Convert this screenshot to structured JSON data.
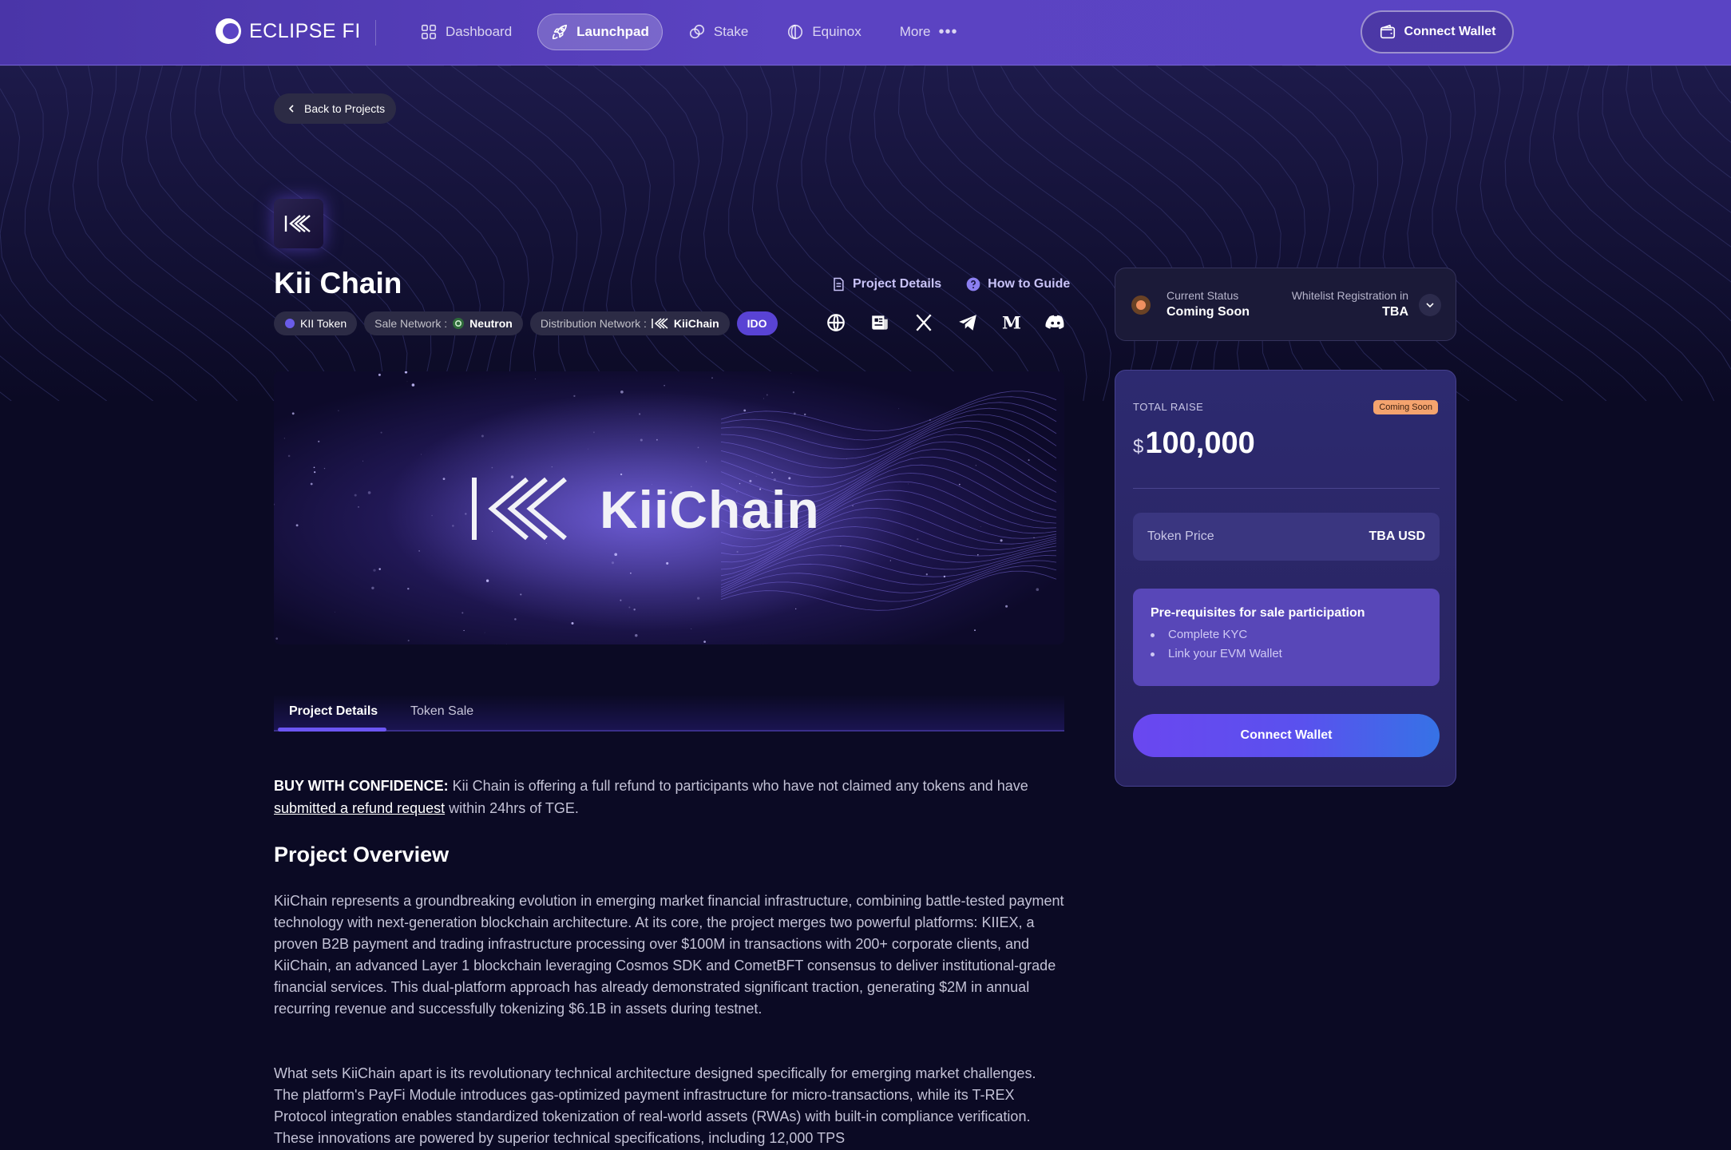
{
  "nav": {
    "brand": "ECLIPSE FI",
    "items": [
      {
        "label": "Dashboard",
        "icon": "grid-icon"
      },
      {
        "label": "Launchpad",
        "icon": "rocket-icon",
        "active": true
      },
      {
        "label": "Stake",
        "icon": "coins-icon"
      },
      {
        "label": "Equinox",
        "icon": "equinox-icon"
      },
      {
        "label": "More",
        "icon": "more-dots-icon"
      }
    ],
    "more_dots": "•••",
    "wallet_label": "Connect Wallet"
  },
  "back": {
    "label": "Back to Projects"
  },
  "project": {
    "title": "Kii Chain",
    "links": {
      "details": "Project Details",
      "guide": "How to Guide"
    },
    "tags": {
      "token": "KII Token",
      "sale_network_label": "Sale Network :",
      "sale_network_value": "Neutron",
      "distribution_label": "Distribution Network :",
      "distribution_value": "KiiChain",
      "type": "IDO"
    },
    "socials": [
      "globe-icon",
      "docs-icon",
      "x-icon",
      "telegram-icon",
      "medium-icon",
      "discord-icon"
    ],
    "banner_text": "KiiChain"
  },
  "tabs": [
    {
      "label": "Project Details",
      "active": true
    },
    {
      "label": "Token Sale",
      "active": false
    }
  ],
  "content": {
    "confidence_bold": "BUY WITH CONFIDENCE:",
    "confidence_text1": " Kii Chain is offering a full refund to participants who have not claimed any tokens and have ",
    "confidence_link": "submitted a refund request",
    "confidence_text2": " within 24hrs of TGE.",
    "overview_title": "Project Overview",
    "para1": "KiiChain represents a groundbreaking evolution in emerging market financial infrastructure, combining battle-tested payment technology with next-generation blockchain architecture. At its core, the project merges two powerful platforms: KIIEX, a proven B2B payment and trading infrastructure processing over $100M in transactions with 200+ corporate clients, and KiiChain, an advanced Layer 1 blockchain leveraging Cosmos SDK and CometBFT consensus to deliver institutional-grade financial services. This dual-platform approach has already demonstrated significant traction, generating $2M in annual recurring revenue and successfully tokenizing $6.1B in assets during testnet.",
    "para2": "What sets KiiChain apart is its revolutionary technical architecture designed specifically for emerging market challenges. The platform's PayFi Module introduces gas-optimized payment infrastructure for micro-transactions, while its T-REX Protocol integration enables standardized tokenization of real-world assets (RWAs) with built-in compliance verification. These innovations are powered by superior technical specifications, including 12,000 TPS"
  },
  "status": {
    "current_label": "Current Status",
    "current_value": "Coming Soon",
    "whitelist_label": "Whitelist Registration in",
    "whitelist_value": "TBA",
    "dot_color": "#f09060"
  },
  "raise": {
    "label": "TOTAL RAISE",
    "badge": "Coming Soon",
    "currency": "$",
    "amount": "100,000",
    "token_price_label": "Token Price",
    "token_price_value": "TBA USD",
    "prereq_title": "Pre-requisites for sale participation",
    "prereq_items": [
      "Complete KYC",
      "Link your EVM Wallet"
    ],
    "cta_label": "Connect Wallet"
  },
  "colors": {
    "nav_bg": "#5a44c4",
    "page_bg": "#0b0a24",
    "accent": "#6c56f2",
    "badge_orange": "#f4a36e"
  }
}
